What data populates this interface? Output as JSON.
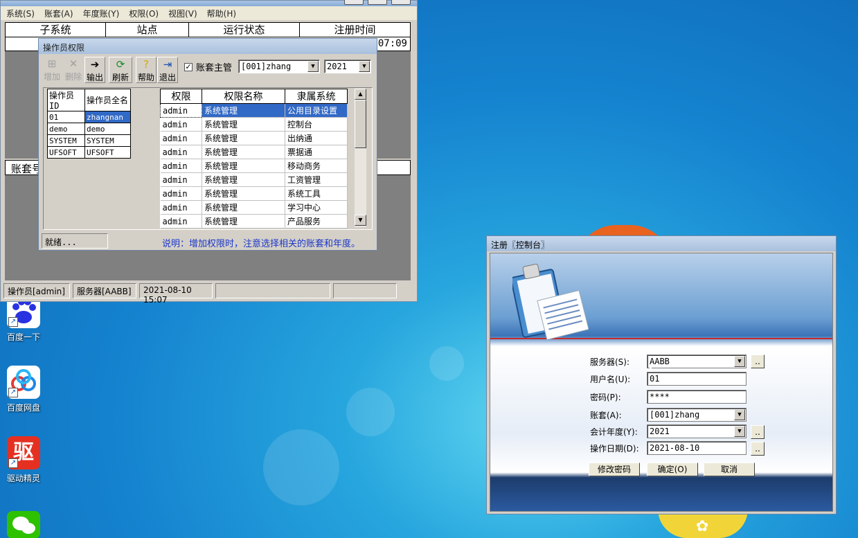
{
  "main_window": {
    "menu": [
      "系统(S)",
      "账套(A)",
      "年度账(Y)",
      "权限(O)",
      "视图(V)",
      "帮助(H)"
    ],
    "grid_columns": [
      "子系统",
      "站点",
      "运行状态",
      "注册时间"
    ],
    "row_time_fragment": "07:09",
    "account_header_fragment": "账套号",
    "status": {
      "operator": "操作员[admin]",
      "server": "服务器[AABB]",
      "datetime": "2021-08-10 15:07"
    }
  },
  "perm_dialog": {
    "title": "操作员权限",
    "toolbar": {
      "add": "增加",
      "delete": "删除",
      "export": "输出",
      "refresh": "刷新",
      "help": "帮助",
      "exit": "退出"
    },
    "checkbox_label": "账套主管",
    "account_select": "[001]zhang",
    "year_select": "2021",
    "operator_table": {
      "headers": [
        "操作员ID",
        "操作员全名"
      ],
      "rows": [
        [
          "01",
          "zhangnan"
        ],
        [
          "demo",
          "demo"
        ],
        [
          "SYSTEM",
          "SYSTEM"
        ],
        [
          "UFSOFT",
          "UFSOFT"
        ]
      ]
    },
    "permission_table": {
      "headers": [
        "权限",
        "权限名称",
        "隶属系统"
      ],
      "rows": [
        [
          "admin",
          "系统管理",
          "公用目录设置"
        ],
        [
          "admin",
          "系统管理",
          "控制台"
        ],
        [
          "admin",
          "系统管理",
          "出纳通"
        ],
        [
          "admin",
          "系统管理",
          "票据通"
        ],
        [
          "admin",
          "系统管理",
          "移动商务"
        ],
        [
          "admin",
          "系统管理",
          "工资管理"
        ],
        [
          "admin",
          "系统管理",
          "系统工具"
        ],
        [
          "admin",
          "系统管理",
          "学习中心"
        ],
        [
          "admin",
          "系统管理",
          "产品服务"
        ]
      ]
    },
    "status": "就绪...",
    "note": "说明：增加权限时，注意选择相关的账套和年度。"
  },
  "login_dialog": {
    "title": "注册〖控制台〗",
    "server_label": "服务器(S):",
    "server_value": "AABB",
    "user_label": "用户名(U):",
    "user_value": "01",
    "password_label": "密码(P):",
    "password_value": "****",
    "account_label": "账套(A):",
    "account_value": "[001]zhang",
    "year_label": "会计年度(Y):",
    "year_value": "2021",
    "date_label": "操作日期(D):",
    "date_value": "2021-08-10",
    "ellipsis": "..",
    "change_password_button": "修改密码",
    "ok_button": "确定(O)",
    "cancel_button": "取消"
  },
  "desktop": {
    "icons": [
      "百度一下",
      "百度网盘",
      "驱动精灵"
    ],
    "driver_glyph": "驱"
  }
}
